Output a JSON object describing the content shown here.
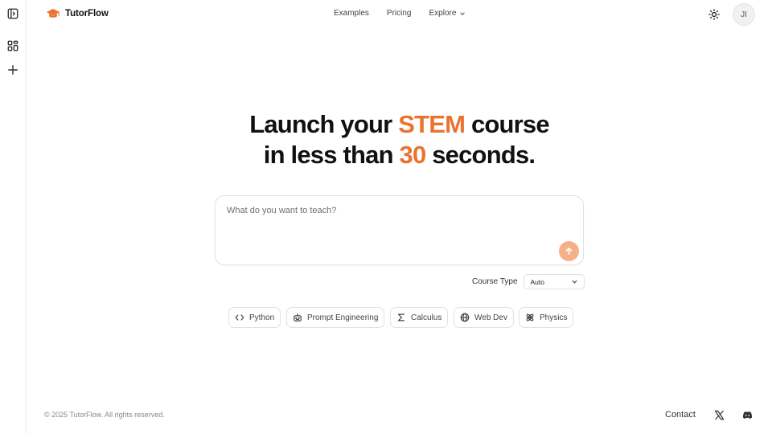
{
  "app": {
    "brand": "TutorFlow",
    "accent_color": "#ea7330",
    "send_button_color": "#f6b088"
  },
  "sidebar": {
    "items": [
      {
        "icon": "sidebar-toggle-icon"
      },
      {
        "icon": "grid-icon"
      },
      {
        "icon": "plus-icon"
      }
    ]
  },
  "nav": {
    "examples": "Examples",
    "pricing": "Pricing",
    "explore": "Explore"
  },
  "header": {
    "theme_icon": "sun-icon",
    "avatar_initials": "JI"
  },
  "hero": {
    "line1_before": "Launch your ",
    "line1_accent": "STEM",
    "line1_after": " course",
    "line2_before": "in less than ",
    "line2_accent": "30",
    "line2_after": " seconds."
  },
  "prompt": {
    "placeholder": "What do you want to teach?",
    "value": ""
  },
  "course_type": {
    "label": "Course Type",
    "selected": "Auto"
  },
  "chips": [
    {
      "label": "Python",
      "icon": "code-icon"
    },
    {
      "label": "Prompt Engineering",
      "icon": "robot-icon"
    },
    {
      "label": "Calculus",
      "icon": "sigma-icon"
    },
    {
      "label": "Web Dev",
      "icon": "globe-icon"
    },
    {
      "label": "Physics",
      "icon": "atom-icon"
    }
  ],
  "footer": {
    "copyright": "© 2025 TutorFlow. All rights reserved.",
    "contact": "Contact"
  }
}
